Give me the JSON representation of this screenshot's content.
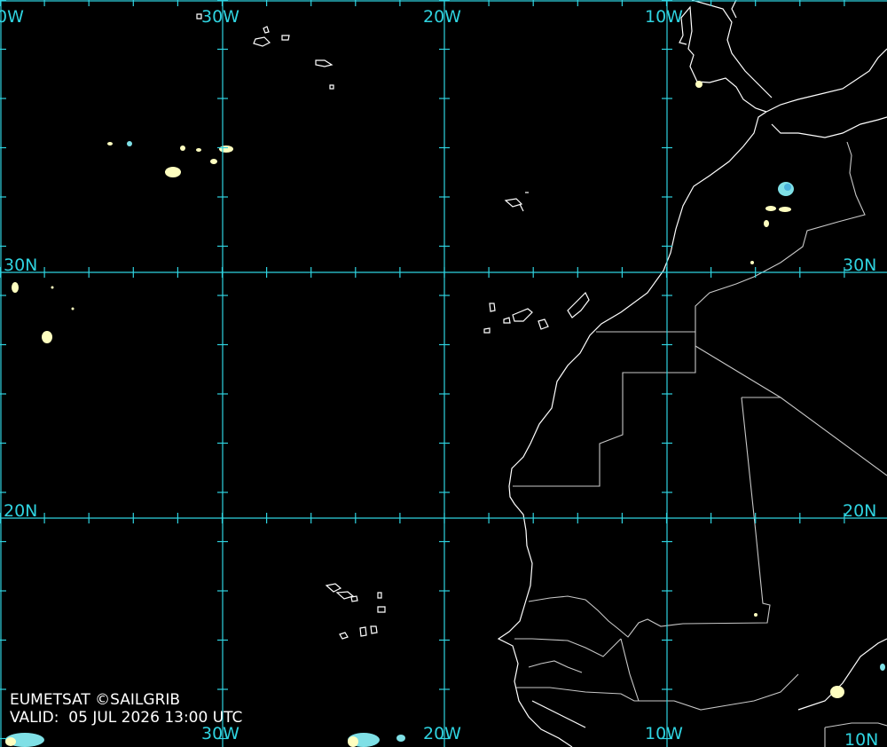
{
  "map": {
    "background_color": "#000000",
    "grid_color": "#2fd3e0",
    "coast_color": "#ffffff",
    "border_color": "#c8c8c8",
    "cloud_colors": [
      "#ffffc0",
      "#7fe0e6",
      "#4ab2dc"
    ],
    "grid_labels": {
      "lon_top": [
        "0W",
        "30W",
        "20W",
        "10W"
      ],
      "lon_bottom": [
        "30W",
        "20W",
        "10W"
      ],
      "lat_left": [
        "30N",
        "20N"
      ],
      "lat_right": [
        "30N",
        "20N",
        "10N"
      ]
    }
  },
  "credit": {
    "source": "EUMETSAT ©SAILGRIB",
    "valid": "VALID:  05 JUL 2026 13:00 UTC"
  }
}
